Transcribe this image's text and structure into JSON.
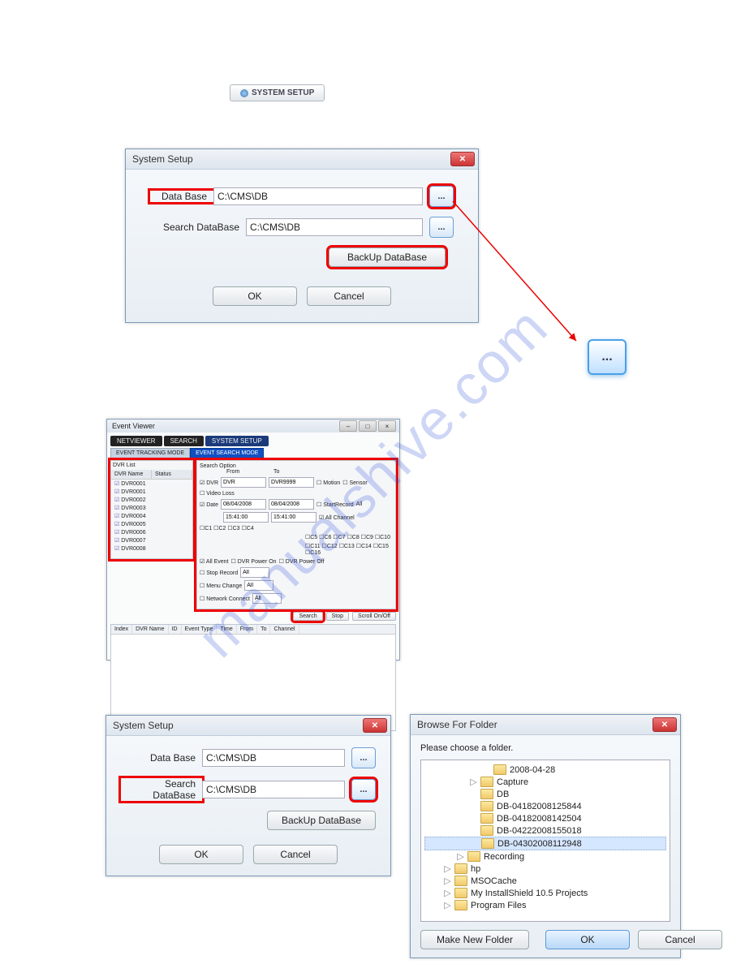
{
  "watermark": "manualshive.com",
  "system_setup_button": "SYSTEM SETUP",
  "dialog1": {
    "title": "System Setup",
    "row1_label": "Data Base",
    "row1_value": "C:\\CMS\\DB",
    "row2_label": "Search DataBase",
    "row2_value": "C:\\CMS\\DB",
    "backup_btn": "BackUp DataBase",
    "ok": "OK",
    "cancel": "Cancel",
    "browse": "..."
  },
  "dialog2": {
    "title": "System Setup",
    "row1_label": "Data Base",
    "row1_value": "C:\\CMS\\DB",
    "row2_label": "Search DataBase",
    "row2_value": "C:\\CMS\\DB",
    "backup_btn": "BackUp DataBase",
    "ok": "OK",
    "cancel": "Cancel",
    "browse": "..."
  },
  "big_browse": "...",
  "event_viewer": {
    "title": "Event Viewer",
    "tabs": {
      "netviewer": "NETVIEWER",
      "search": "SEARCH",
      "system": "SYSTEM SETUP"
    },
    "subtabs": {
      "tracking": "EVENT TRACKING MODE",
      "search_mode": "EVENT SEARCH MODE"
    },
    "dvr_section_label": "DVR List",
    "dvr_header": {
      "name": "DVR Name",
      "status": "Status"
    },
    "dvr_rows": [
      "DVR0001",
      "DVR0001",
      "DVR0002",
      "DVR0003",
      "DVR0004",
      "DVR0005",
      "DVR0006",
      "DVR0007",
      "DVR0008"
    ],
    "search_option_label": "Search Option",
    "from": "From",
    "to": "To",
    "dvr_label": "DVR",
    "dvr_val": "DVR",
    "dvr_to_val": "DVR9999",
    "date_label": "Date",
    "date_from": "08/04/2008",
    "date_to": "08/04/2008",
    "time_from": "15:41:00",
    "time_to": "15:41:00",
    "motion": "Motion",
    "sensor": "Sensor",
    "video_loss": "Video Loss",
    "start_record": "StartRecord",
    "all": "All",
    "all_channel": "All Channel",
    "channels": [
      "C1",
      "C2",
      "C3",
      "C4",
      "C5",
      "C6",
      "C7",
      "C8",
      "C9",
      "C10",
      "C11",
      "C12",
      "C13",
      "C14",
      "C15",
      "C16"
    ],
    "all_event": "All Event",
    "dvr_power_on": "DVR Power On",
    "dvr_power_off": "DVR Power Off",
    "stop_record": "Stop Record",
    "menu_change": "Menu Change",
    "network_connect": "Network Connect",
    "search_btn": "Search",
    "stop_btn": "Stop",
    "scroll_btn": "Scroll On/Off",
    "grid_headers": [
      "Index",
      "DVR Name",
      "ID",
      "Event Type",
      "Time",
      "From",
      "To",
      "Channel"
    ]
  },
  "browse_dialog": {
    "title": "Browse For Folder",
    "subtitle": "Please choose a folder.",
    "items": [
      {
        "indent": 3,
        "label": "2008-04-28"
      },
      {
        "indent": 2,
        "expander": "▷",
        "label": "Capture"
      },
      {
        "indent": 2,
        "label": "DB"
      },
      {
        "indent": 2,
        "label": "DB-04182008125844"
      },
      {
        "indent": 2,
        "label": "DB-04182008142504"
      },
      {
        "indent": 2,
        "label": "DB-04222008155018"
      },
      {
        "indent": 2,
        "selected": true,
        "label": "DB-04302008112948"
      },
      {
        "indent": 1,
        "expander": "▷",
        "label": "Recording"
      },
      {
        "indent": 0,
        "expander": "▷",
        "label": "hp"
      },
      {
        "indent": 0,
        "expander": "▷",
        "label": "MSOCache"
      },
      {
        "indent": 0,
        "expander": "▷",
        "label": "My InstallShield 10.5 Projects"
      },
      {
        "indent": 0,
        "expander": "▷",
        "label": "Program Files"
      }
    ],
    "make_new": "Make New Folder",
    "ok": "OK",
    "cancel": "Cancel"
  }
}
